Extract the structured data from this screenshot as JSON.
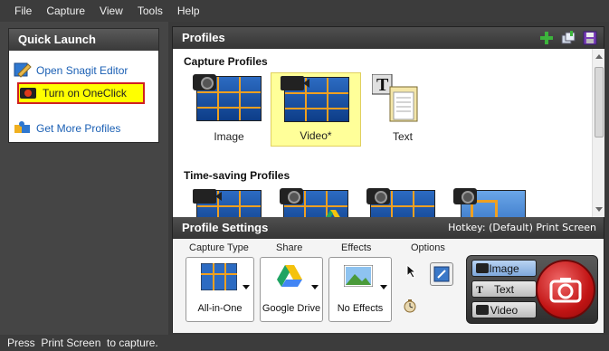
{
  "menu": [
    "File",
    "Capture",
    "View",
    "Tools",
    "Help"
  ],
  "quick_launch": {
    "title": "Quick Launch",
    "items": [
      {
        "label": "Open Snagit Editor",
        "icon": "snagit-editor-icon"
      },
      {
        "label": "Turn on OneClick",
        "icon": "oneclick-icon"
      },
      {
        "label": "Get More Profiles",
        "icon": "puzzle-icon"
      }
    ]
  },
  "profiles": {
    "title": "Profiles",
    "tools": [
      "add-profile-icon",
      "manage-profiles-icon",
      "save-profile-icon"
    ],
    "capture_section": "Capture Profiles",
    "capture_items": [
      {
        "label": "Image",
        "icon": "camera-icon"
      },
      {
        "label": "Video*",
        "icon": "video-camera-icon",
        "selected": true
      },
      {
        "label": "Text",
        "icon": "text-capture-icon"
      }
    ],
    "timesaving_section": "Time-saving Profiles"
  },
  "profile_settings": {
    "title": "Profile Settings",
    "hotkey": "Hotkey: (Default) Print Screen",
    "columns": {
      "capture_type": {
        "label": "Capture Type",
        "value": "All-in-One"
      },
      "share": {
        "label": "Share",
        "value": "Google Drive"
      },
      "effects": {
        "label": "Effects",
        "value": "No Effects"
      },
      "options": {
        "label": "Options"
      }
    },
    "modes": [
      {
        "label": "Image",
        "active": true
      },
      {
        "label": "Text",
        "active": false
      },
      {
        "label": "Video",
        "active": false
      }
    ]
  },
  "status": "Press  Print Screen  to capture.",
  "colors": {
    "accent_blue": "#1a5fb4",
    "grid_orange": "#f0a020",
    "highlight_yellow": "#ffff00",
    "capture_red": "#c21414"
  }
}
